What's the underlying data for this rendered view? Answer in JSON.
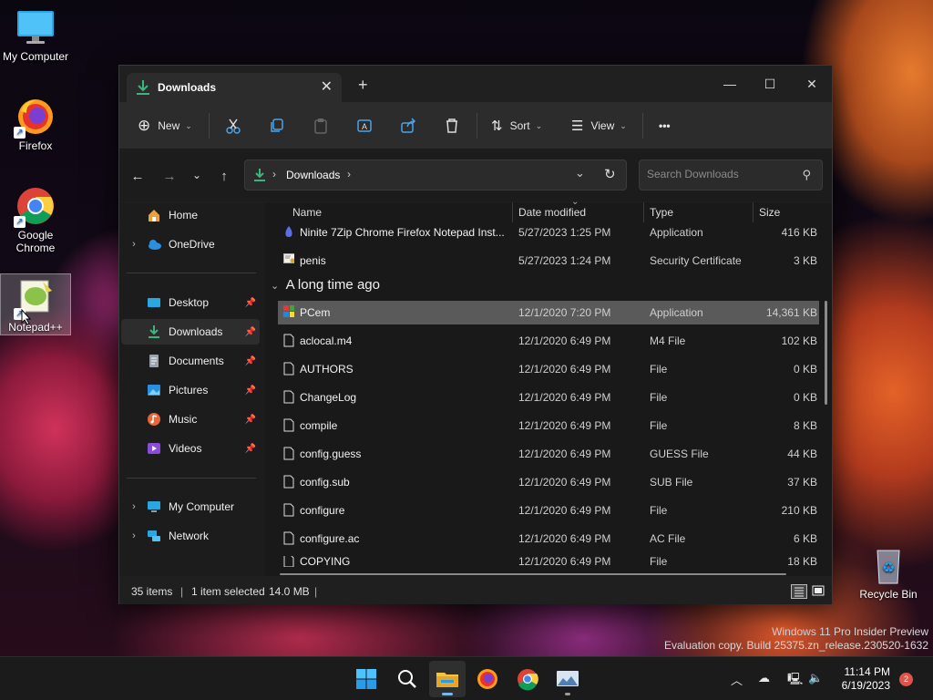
{
  "desktop": {
    "icons": [
      {
        "label": "My Computer"
      },
      {
        "label": "Firefox"
      },
      {
        "label": "Google Chrome"
      },
      {
        "label": "Notepad++"
      },
      {
        "label": "Recycle Bin"
      }
    ],
    "watermark": {
      "line1": "Windows 11 Pro Insider Preview",
      "line2": "Evaluation copy. Build 25375.zn_release.230520-1632"
    }
  },
  "window": {
    "tab_title": "Downloads",
    "toolbar": {
      "new_label": "New",
      "sort_label": "Sort",
      "view_label": "View",
      "more_label": "•••"
    },
    "address": {
      "crumb": "Downloads",
      "separator": "›"
    },
    "search": {
      "placeholder": "Search Downloads"
    },
    "nav": {
      "home": "Home",
      "onedrive": "OneDrive",
      "desktop": "Desktop",
      "downloads": "Downloads",
      "documents": "Documents",
      "pictures": "Pictures",
      "music": "Music",
      "videos": "Videos",
      "my_computer": "My Computer",
      "network": "Network"
    },
    "columns": {
      "name": "Name",
      "date": "Date modified",
      "type": "Type",
      "size": "Size"
    },
    "top_rows": [
      {
        "name": "Ninite 7Zip Chrome Firefox Notepad Inst...",
        "date": "5/27/2023 1:25 PM",
        "type": "Application",
        "size": "416 KB"
      },
      {
        "name": "penis",
        "date": "5/27/2023 1:24 PM",
        "type": "Security Certificate",
        "size": "3 KB"
      }
    ],
    "group_label": "A long time ago",
    "rows": [
      {
        "name": "PCem",
        "date": "12/1/2020 7:20 PM",
        "type": "Application",
        "size": "14,361 KB"
      },
      {
        "name": "aclocal.m4",
        "date": "12/1/2020 6:49 PM",
        "type": "M4 File",
        "size": "102 KB"
      },
      {
        "name": "AUTHORS",
        "date": "12/1/2020 6:49 PM",
        "type": "File",
        "size": "0 KB"
      },
      {
        "name": "ChangeLog",
        "date": "12/1/2020 6:49 PM",
        "type": "File",
        "size": "0 KB"
      },
      {
        "name": "compile",
        "date": "12/1/2020 6:49 PM",
        "type": "File",
        "size": "8 KB"
      },
      {
        "name": "config.guess",
        "date": "12/1/2020 6:49 PM",
        "type": "GUESS File",
        "size": "44 KB"
      },
      {
        "name": "config.sub",
        "date": "12/1/2020 6:49 PM",
        "type": "SUB File",
        "size": "37 KB"
      },
      {
        "name": "configure",
        "date": "12/1/2020 6:49 PM",
        "type": "File",
        "size": "210 KB"
      },
      {
        "name": "configure.ac",
        "date": "12/1/2020 6:49 PM",
        "type": "AC File",
        "size": "6 KB"
      },
      {
        "name": "COPYING",
        "date": "12/1/2020 6:49 PM",
        "type": "File",
        "size": "18 KB"
      }
    ],
    "status": {
      "items": "35 items",
      "selected": "1 item selected",
      "size": "14.0 MB",
      "sep": "|"
    }
  },
  "taskbar": {
    "time": "11:14 PM",
    "date": "6/19/2023",
    "notification_count": "2"
  },
  "colors": {
    "accent": "#76b9ed",
    "download_green": "#3fb37f",
    "selected_row": "#5a5a5a",
    "badge": "#e0524a"
  }
}
